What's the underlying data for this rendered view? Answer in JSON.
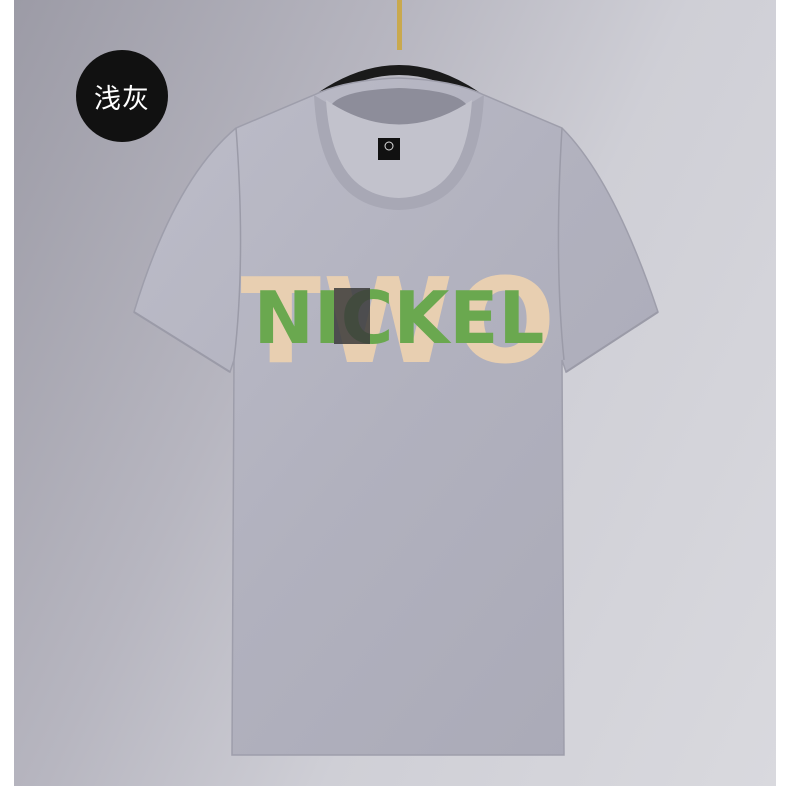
{
  "product": {
    "color_badge": "浅灰",
    "print_front_word": "NICKEL",
    "print_back_word": "TWO",
    "shirt_color": "#b3b3bf",
    "print_green": "#6aa84f",
    "print_beige": "#e8cfb1",
    "print_dark": "#3b3b3b",
    "hanger_color": "#1a1a1a"
  }
}
